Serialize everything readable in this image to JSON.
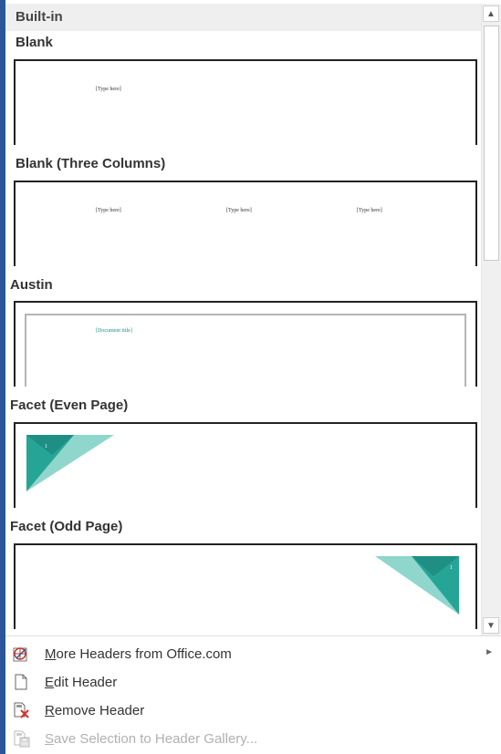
{
  "gallery": {
    "section_label": "Built-in",
    "items": [
      {
        "title": "Blank",
        "placeholders": [
          "[Type here]"
        ]
      },
      {
        "title": "Blank (Three Columns)",
        "placeholders": [
          "[Type here]",
          "[Type here]",
          "[Type here]"
        ]
      },
      {
        "title": "Austin",
        "placeholders": [
          "[Document title]"
        ]
      },
      {
        "title": "Facet (Even Page)",
        "placeholders": [
          "1"
        ]
      },
      {
        "title": "Facet (Odd Page)",
        "placeholders": [
          "1"
        ]
      }
    ]
  },
  "scrollbar": {
    "up_arrow": "▲",
    "down_arrow": "▼"
  },
  "menu": {
    "items": [
      {
        "accel": "M",
        "rest": "ore Headers from Office.com",
        "icon": "office-web-icon",
        "enabled": true,
        "submenu": true
      },
      {
        "accel": "E",
        "rest": "dit Header",
        "icon": "document-page-icon",
        "enabled": true,
        "submenu": false
      },
      {
        "accel": "R",
        "rest": "emove Header",
        "icon": "remove-header-icon",
        "enabled": true,
        "submenu": false
      },
      {
        "accel": "S",
        "rest": "ave Selection to Header Gallery...",
        "icon": "save-to-gallery-icon",
        "enabled": false,
        "submenu": false
      }
    ],
    "submenu_arrow": "►"
  },
  "colors": {
    "accent_teal": "#1e9e8f",
    "teal_light": "#4fc1b4",
    "frame_blue": "#2b579a"
  }
}
